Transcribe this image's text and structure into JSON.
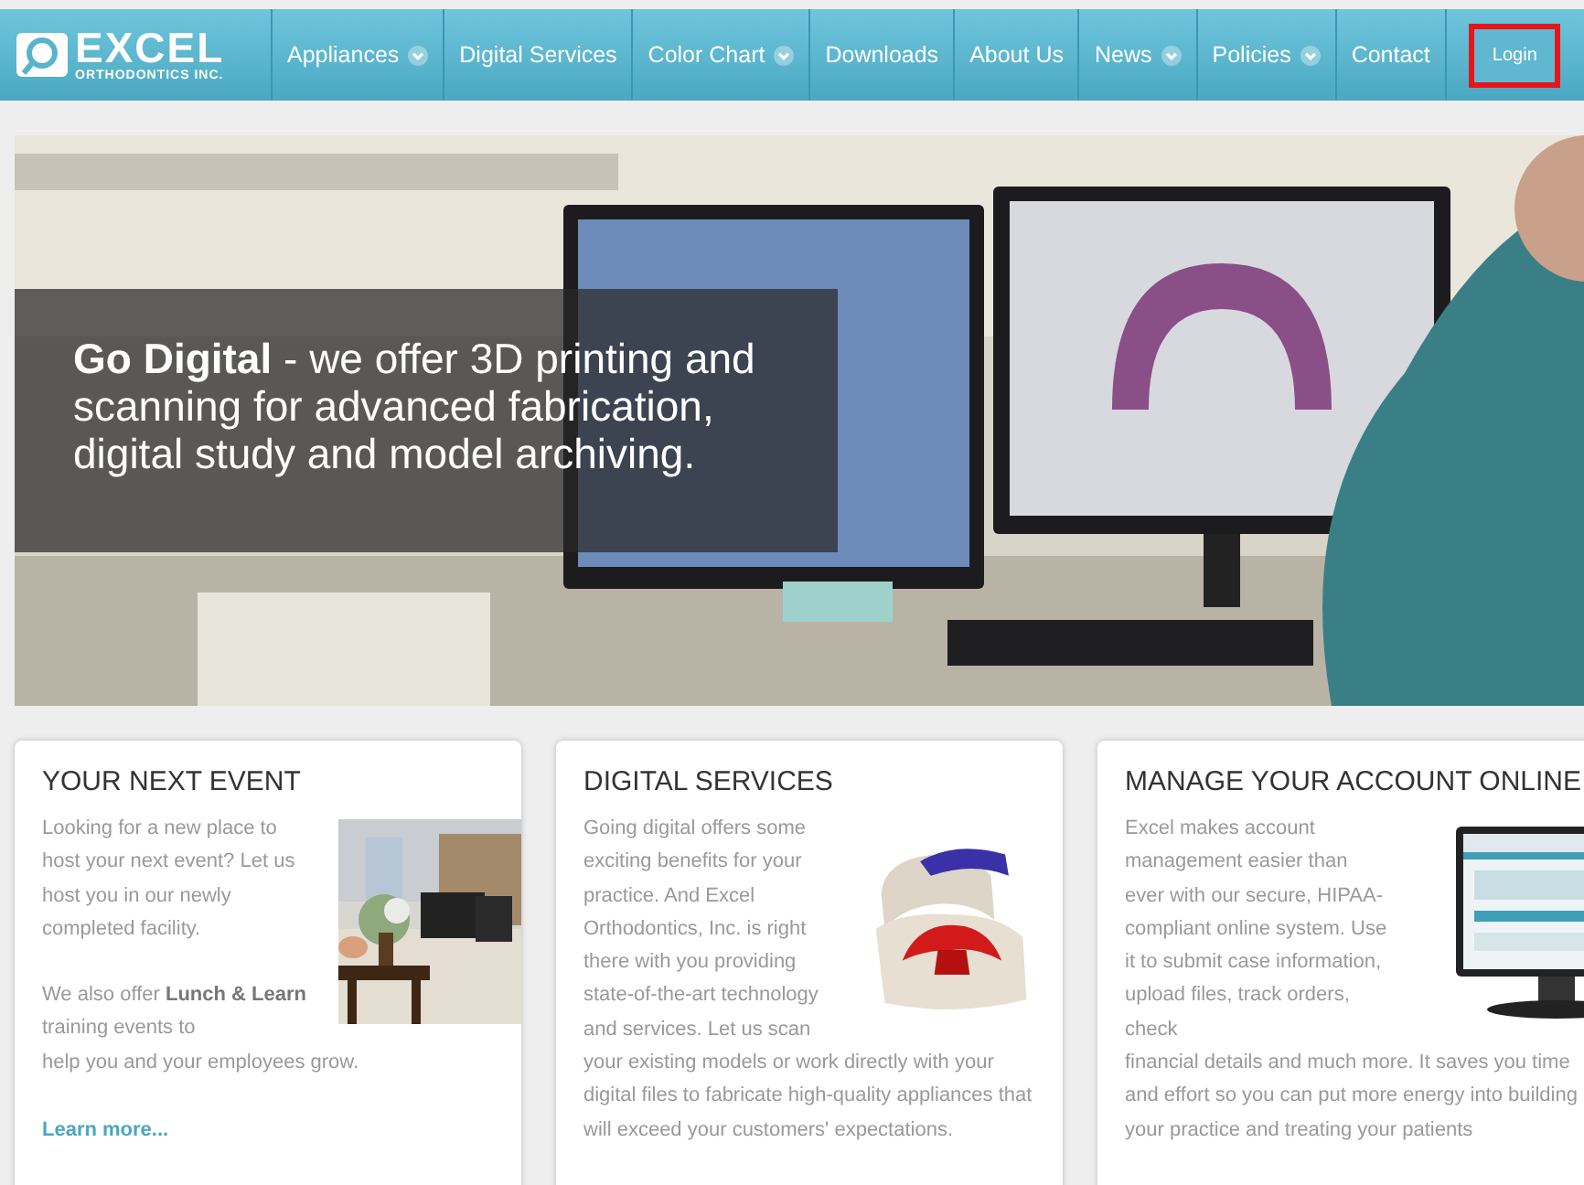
{
  "logo": {
    "name": "EXCEL",
    "tagline": "ORTHODONTICS INC."
  },
  "nav": [
    {
      "label": "Appliances",
      "dropdown": true
    },
    {
      "label": "Digital Services",
      "dropdown": false
    },
    {
      "label": "Color Chart",
      "dropdown": true
    },
    {
      "label": "Downloads",
      "dropdown": false
    },
    {
      "label": "About Us",
      "dropdown": false
    },
    {
      "label": "News",
      "dropdown": true
    },
    {
      "label": "Policies",
      "dropdown": true
    },
    {
      "label": "Contact",
      "dropdown": false
    }
  ],
  "login": {
    "label": "Login"
  },
  "hero": {
    "kind": "picture",
    "caption": "**Go Digital** - we offer 3D printing and scanning for advanced fabrication, digital study and model archiving."
  },
  "cards": [
    {
      "title": "YOUR NEXT EVENT",
      "side": [
        "Looking for a new place to host your next event? Let us host you in our newly completed facility.",
        "We also offer **Lunch &** **Learn** training events to"
      ],
      "below": [
        "help you and your employees grow."
      ],
      "link": "Learn more..."
    },
    {
      "title": "DIGITAL SERVICES",
      "side": [
        "Going digital offers some exciting benefits for your practice. And Excel Orthodontics, Inc. is right there with you providing state-of-the-art technology and services. Let us scan"
      ],
      "below": [
        "your existing models or work directly with your digital files to fabricate high-quality appliances that will exceed your customers' expectations."
      ]
    },
    {
      "title": "MANAGE YOUR ACCOUNT ONLINE",
      "side": [
        "Excel makes account management easier than ever with our secure, HIPAA-compliant online system. Use it to submit case information, upload files, track orders, check"
      ],
      "below": [
        "financial details and much more. It saves you time and effort so you can put more energy into building your practice and treating your patients"
      ]
    }
  ]
}
